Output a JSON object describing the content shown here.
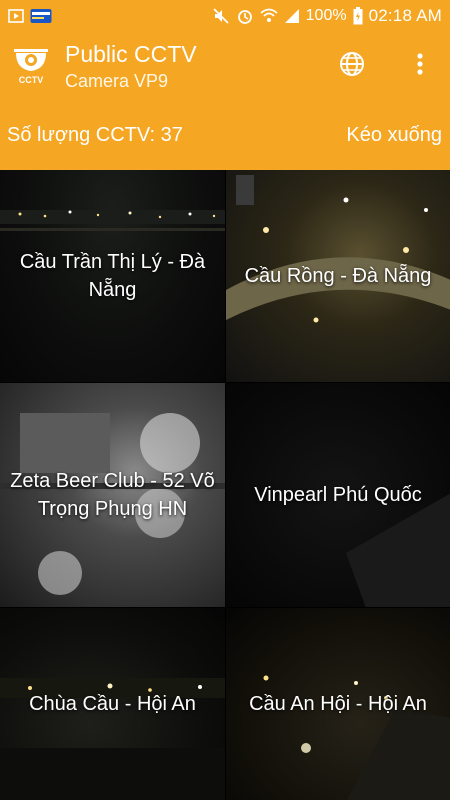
{
  "status_bar": {
    "battery": "100%",
    "time": "02:18 AM",
    "icons": [
      "media-icon",
      "carrier-badge-icon",
      "mute-icon",
      "alarm-icon",
      "wifi-icon",
      "signal-icon",
      "battery-icon"
    ]
  },
  "app_bar": {
    "title": "Public CCTV",
    "subtitle": "Camera VP9",
    "logo_text": "CCTV",
    "actions": [
      "globe-icon",
      "more-vert-icon"
    ]
  },
  "info_bar": {
    "count_label": "Số lượng CCTV: 37",
    "pull_label": "Kéo xuống"
  },
  "cameras": [
    {
      "name": "Cầu Trần Thị Lý - Đà Nẵng"
    },
    {
      "name": "Cầu Rồng - Đà Nẵng"
    },
    {
      "name": "Zeta Beer Club - 52 Võ Trọng Phụng HN"
    },
    {
      "name": "Vinpearl Phú Quốc"
    },
    {
      "name": "Chùa Cầu - Hội An"
    },
    {
      "name": "Cầu An Hội - Hội An"
    }
  ],
  "colors": {
    "accent": "#F5A623",
    "text_on_accent": "#FFFFFF"
  }
}
